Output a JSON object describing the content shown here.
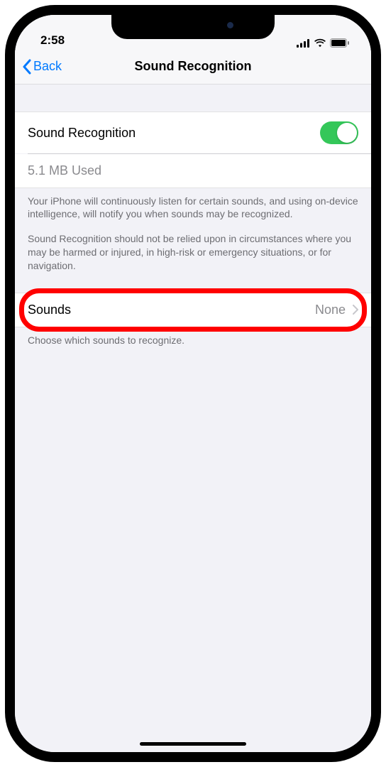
{
  "status": {
    "time": "2:58"
  },
  "nav": {
    "backLabel": "Back",
    "title": "Sound Recognition"
  },
  "group1": {
    "toggleLabel": "Sound Recognition",
    "toggleOn": true,
    "storageText": "5.1 MB Used",
    "footerPara1": "Your iPhone will continuously listen for certain sounds, and using on-device intelligence, will notify you when sounds may be recognized.",
    "footerPara2": "Sound Recognition should not be relied upon in circumstances where you may be harmed or injured, in high-risk or emergency situations, or for navigation."
  },
  "group2": {
    "linkLabel": "Sounds",
    "linkValue": "None",
    "footer": "Choose which sounds to recognize."
  }
}
